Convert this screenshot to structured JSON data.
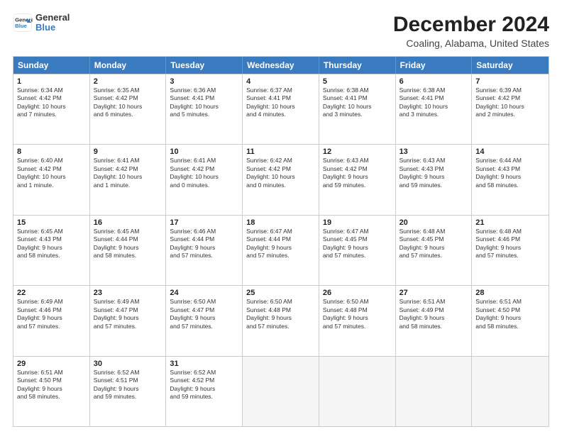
{
  "header": {
    "logo_line1": "General",
    "logo_line2": "Blue",
    "title": "December 2024",
    "subtitle": "Coaling, Alabama, United States"
  },
  "days_of_week": [
    "Sunday",
    "Monday",
    "Tuesday",
    "Wednesday",
    "Thursday",
    "Friday",
    "Saturday"
  ],
  "weeks": [
    [
      {
        "day": "1",
        "info": "Sunrise: 6:34 AM\nSunset: 4:42 PM\nDaylight: 10 hours\nand 7 minutes."
      },
      {
        "day": "2",
        "info": "Sunrise: 6:35 AM\nSunset: 4:42 PM\nDaylight: 10 hours\nand 6 minutes."
      },
      {
        "day": "3",
        "info": "Sunrise: 6:36 AM\nSunset: 4:41 PM\nDaylight: 10 hours\nand 5 minutes."
      },
      {
        "day": "4",
        "info": "Sunrise: 6:37 AM\nSunset: 4:41 PM\nDaylight: 10 hours\nand 4 minutes."
      },
      {
        "day": "5",
        "info": "Sunrise: 6:38 AM\nSunset: 4:41 PM\nDaylight: 10 hours\nand 3 minutes."
      },
      {
        "day": "6",
        "info": "Sunrise: 6:38 AM\nSunset: 4:41 PM\nDaylight: 10 hours\nand 3 minutes."
      },
      {
        "day": "7",
        "info": "Sunrise: 6:39 AM\nSunset: 4:42 PM\nDaylight: 10 hours\nand 2 minutes."
      }
    ],
    [
      {
        "day": "8",
        "info": "Sunrise: 6:40 AM\nSunset: 4:42 PM\nDaylight: 10 hours\nand 1 minute."
      },
      {
        "day": "9",
        "info": "Sunrise: 6:41 AM\nSunset: 4:42 PM\nDaylight: 10 hours\nand 1 minute."
      },
      {
        "day": "10",
        "info": "Sunrise: 6:41 AM\nSunset: 4:42 PM\nDaylight: 10 hours\nand 0 minutes."
      },
      {
        "day": "11",
        "info": "Sunrise: 6:42 AM\nSunset: 4:42 PM\nDaylight: 10 hours\nand 0 minutes."
      },
      {
        "day": "12",
        "info": "Sunrise: 6:43 AM\nSunset: 4:42 PM\nDaylight: 9 hours\nand 59 minutes."
      },
      {
        "day": "13",
        "info": "Sunrise: 6:43 AM\nSunset: 4:43 PM\nDaylight: 9 hours\nand 59 minutes."
      },
      {
        "day": "14",
        "info": "Sunrise: 6:44 AM\nSunset: 4:43 PM\nDaylight: 9 hours\nand 58 minutes."
      }
    ],
    [
      {
        "day": "15",
        "info": "Sunrise: 6:45 AM\nSunset: 4:43 PM\nDaylight: 9 hours\nand 58 minutes."
      },
      {
        "day": "16",
        "info": "Sunrise: 6:45 AM\nSunset: 4:44 PM\nDaylight: 9 hours\nand 58 minutes."
      },
      {
        "day": "17",
        "info": "Sunrise: 6:46 AM\nSunset: 4:44 PM\nDaylight: 9 hours\nand 57 minutes."
      },
      {
        "day": "18",
        "info": "Sunrise: 6:47 AM\nSunset: 4:44 PM\nDaylight: 9 hours\nand 57 minutes."
      },
      {
        "day": "19",
        "info": "Sunrise: 6:47 AM\nSunset: 4:45 PM\nDaylight: 9 hours\nand 57 minutes."
      },
      {
        "day": "20",
        "info": "Sunrise: 6:48 AM\nSunset: 4:45 PM\nDaylight: 9 hours\nand 57 minutes."
      },
      {
        "day": "21",
        "info": "Sunrise: 6:48 AM\nSunset: 4:46 PM\nDaylight: 9 hours\nand 57 minutes."
      }
    ],
    [
      {
        "day": "22",
        "info": "Sunrise: 6:49 AM\nSunset: 4:46 PM\nDaylight: 9 hours\nand 57 minutes."
      },
      {
        "day": "23",
        "info": "Sunrise: 6:49 AM\nSunset: 4:47 PM\nDaylight: 9 hours\nand 57 minutes."
      },
      {
        "day": "24",
        "info": "Sunrise: 6:50 AM\nSunset: 4:47 PM\nDaylight: 9 hours\nand 57 minutes."
      },
      {
        "day": "25",
        "info": "Sunrise: 6:50 AM\nSunset: 4:48 PM\nDaylight: 9 hours\nand 57 minutes."
      },
      {
        "day": "26",
        "info": "Sunrise: 6:50 AM\nSunset: 4:48 PM\nDaylight: 9 hours\nand 57 minutes."
      },
      {
        "day": "27",
        "info": "Sunrise: 6:51 AM\nSunset: 4:49 PM\nDaylight: 9 hours\nand 58 minutes."
      },
      {
        "day": "28",
        "info": "Sunrise: 6:51 AM\nSunset: 4:50 PM\nDaylight: 9 hours\nand 58 minutes."
      }
    ],
    [
      {
        "day": "29",
        "info": "Sunrise: 6:51 AM\nSunset: 4:50 PM\nDaylight: 9 hours\nand 58 minutes."
      },
      {
        "day": "30",
        "info": "Sunrise: 6:52 AM\nSunset: 4:51 PM\nDaylight: 9 hours\nand 59 minutes."
      },
      {
        "day": "31",
        "info": "Sunrise: 6:52 AM\nSunset: 4:52 PM\nDaylight: 9 hours\nand 59 minutes."
      },
      {
        "day": "",
        "info": ""
      },
      {
        "day": "",
        "info": ""
      },
      {
        "day": "",
        "info": ""
      },
      {
        "day": "",
        "info": ""
      }
    ]
  ]
}
